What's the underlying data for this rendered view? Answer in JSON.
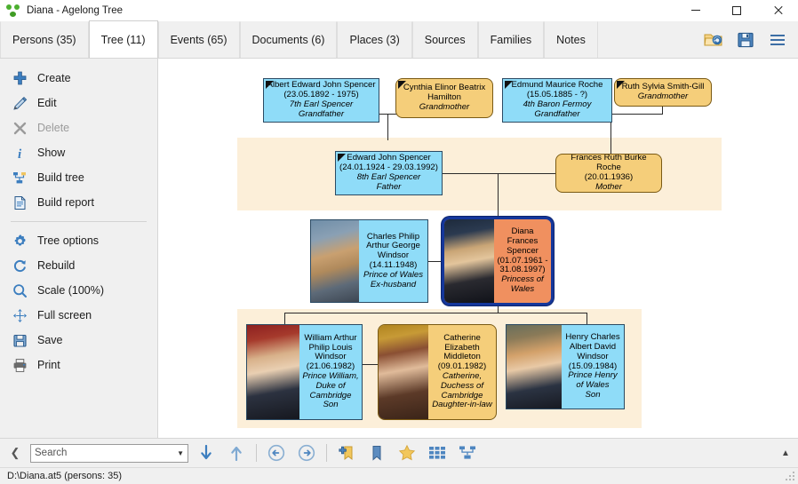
{
  "window": {
    "title": "Diana - Agelong Tree",
    "app_icon": "agelong-tree-icon",
    "minimize_label": "",
    "maximize_label": "",
    "close_label": ""
  },
  "tabs": [
    {
      "label": "Persons (35)",
      "active": false
    },
    {
      "label": "Tree (11)",
      "active": true
    },
    {
      "label": "Events (65)",
      "active": false
    },
    {
      "label": "Documents (6)",
      "active": false
    },
    {
      "label": "Places (3)",
      "active": false
    },
    {
      "label": "Sources",
      "active": false
    },
    {
      "label": "Families",
      "active": false
    },
    {
      "label": "Notes",
      "active": false
    }
  ],
  "header_tools": [
    {
      "name": "open-folder-icon"
    },
    {
      "name": "save-icon"
    },
    {
      "name": "menu-icon"
    }
  ],
  "sidebar": {
    "items": [
      {
        "label": "Create",
        "icon": "plus-icon",
        "disabled": false
      },
      {
        "label": "Edit",
        "icon": "pencil-icon",
        "disabled": false
      },
      {
        "label": "Delete",
        "icon": "x-icon",
        "disabled": true
      },
      {
        "label": "Show",
        "icon": "info-icon",
        "disabled": false
      },
      {
        "label": "Build tree",
        "icon": "build-tree-icon",
        "disabled": false
      },
      {
        "label": "Build report",
        "icon": "document-icon",
        "disabled": false
      },
      {
        "label": "Tree options",
        "icon": "gear-icon",
        "disabled": false
      },
      {
        "label": "Rebuild",
        "icon": "refresh-icon",
        "disabled": false
      },
      {
        "label": "Scale (100%)",
        "icon": "magnifier-icon",
        "disabled": false
      },
      {
        "label": "Full screen",
        "icon": "fullscreen-icon",
        "disabled": false
      },
      {
        "label": "Save",
        "icon": "save-icon",
        "disabled": false
      },
      {
        "label": "Print",
        "icon": "printer-icon",
        "disabled": false
      }
    ],
    "separator_after_index": 5
  },
  "colors": {
    "male": "#8FDCF8",
    "female": "#F5CE7A",
    "selected": "#F0905F",
    "selected_border": "#15379B",
    "group_band": "#FCEFD9",
    "chrome": "#F0F0F0"
  },
  "tree": {
    "nodes": [
      {
        "id": "albert",
        "name": "Albert Edward John Spencer",
        "dates": "(23.05.1892 - 1975)",
        "title": "7th Earl Spencer",
        "relation": "Grandfather",
        "sex": "male",
        "marked": true,
        "selected": false,
        "photo": false
      },
      {
        "id": "cynthia",
        "name": "Cynthia Elinor Beatrix Hamilton",
        "dates": "",
        "title": "",
        "relation": "Grandmother",
        "sex": "female",
        "marked": true,
        "selected": false,
        "photo": false
      },
      {
        "id": "edmund",
        "name": "Edmund Maurice Roche",
        "dates": "(15.05.1885 - ?)",
        "title": "4th Baron Fermoy",
        "relation": "Grandfather",
        "sex": "male",
        "marked": true,
        "selected": false,
        "photo": false
      },
      {
        "id": "ruth",
        "name": "Ruth Sylvia Smith-Gill",
        "dates": "",
        "title": "",
        "relation": "Grandmother",
        "sex": "female",
        "marked": true,
        "selected": false,
        "photo": false
      },
      {
        "id": "edward",
        "name": "Edward John Spencer",
        "dates": "(24.01.1924 - 29.03.1992)",
        "title": "8th Earl Spencer",
        "relation": "Father",
        "sex": "male",
        "marked": true,
        "selected": false,
        "photo": false
      },
      {
        "id": "frances",
        "name": "Frances Ruth Burke Roche",
        "dates": "(20.01.1936)",
        "title": "",
        "relation": "Mother",
        "sex": "female",
        "marked": false,
        "selected": false,
        "photo": false
      },
      {
        "id": "charles",
        "name": "Charles Philip Arthur George Windsor",
        "dates": "(14.11.1948)",
        "title": "Prince of Wales",
        "relation": "Ex-husband",
        "sex": "male",
        "marked": false,
        "selected": false,
        "photo": true
      },
      {
        "id": "diana",
        "name": "Diana Frances Spencer",
        "dates": "(01.07.1961 - 31.08.1997)",
        "title": "Princess of Wales",
        "relation": "",
        "sex": "female",
        "marked": false,
        "selected": true,
        "photo": true
      },
      {
        "id": "william",
        "name": "William Arthur Philip Louis Windsor",
        "dates": "(21.06.1982)",
        "title": "Prince William, Duke of Cambridge",
        "relation": "Son",
        "sex": "male",
        "marked": false,
        "selected": false,
        "photo": true
      },
      {
        "id": "catherine",
        "name": "Catherine Elizabeth Middleton",
        "dates": "(09.01.1982)",
        "title": "Catherine, Duchess of Cambridge",
        "relation": "Daughter-in-law",
        "sex": "female",
        "marked": false,
        "selected": false,
        "photo": true
      },
      {
        "id": "harry",
        "name": "Henry Charles Albert David Windsor",
        "dates": "(15.09.1984)",
        "title": "Prince Henry of Wales",
        "relation": "Son",
        "sex": "male",
        "marked": false,
        "selected": false,
        "photo": true
      }
    ]
  },
  "bottombar": {
    "collapse_icon": "chevron-left-icon",
    "search": {
      "value": "",
      "placeholder": "Search"
    },
    "buttons": [
      {
        "name": "find-next-icon"
      },
      {
        "name": "find-previous-icon"
      },
      {
        "name": "navigate-back-icon"
      },
      {
        "name": "navigate-forward-icon"
      },
      {
        "name": "add-bookmark-icon"
      },
      {
        "name": "bookmarks-icon"
      },
      {
        "name": "favorites-icon"
      },
      {
        "name": "grid-view-icon"
      },
      {
        "name": "tree-view-icon"
      }
    ],
    "scroll_up_icon": "chevron-up-icon"
  },
  "statusbar": {
    "text": "D:\\Diana.at5 (persons: 35)"
  }
}
